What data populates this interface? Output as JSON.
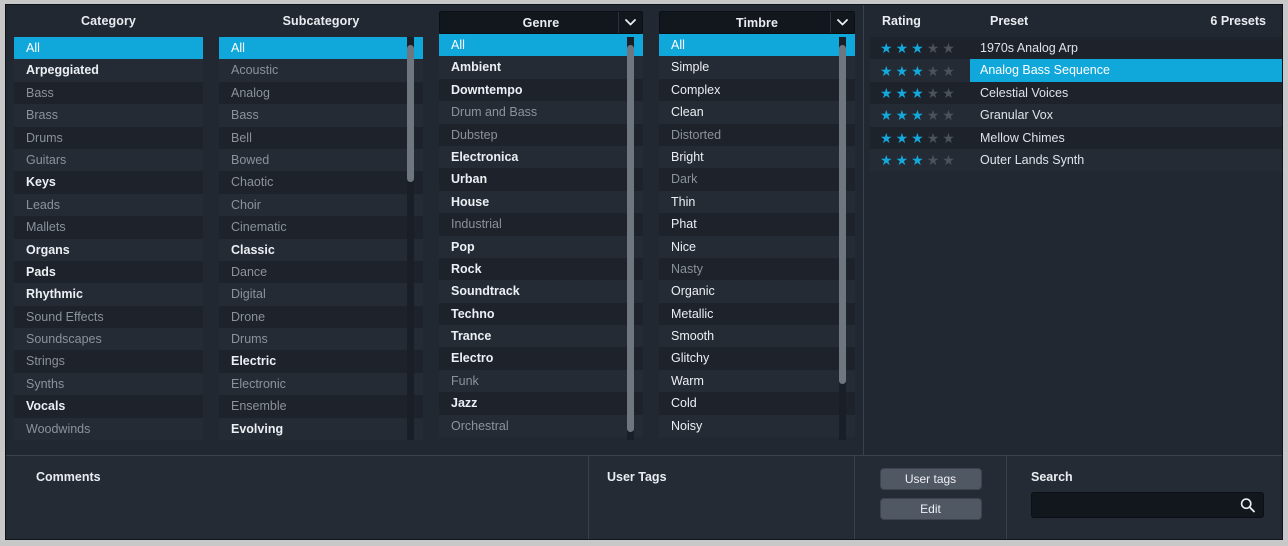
{
  "columns": {
    "category": {
      "title": "Category",
      "type": "static-header",
      "selected": "All",
      "items": [
        {
          "label": "All",
          "state": "selected"
        },
        {
          "label": "Arpeggiated",
          "state": "enabled"
        },
        {
          "label": "Bass",
          "state": "dimmed"
        },
        {
          "label": "Brass",
          "state": "dimmed"
        },
        {
          "label": "Drums",
          "state": "dimmed"
        },
        {
          "label": "Guitars",
          "state": "dimmed"
        },
        {
          "label": "Keys",
          "state": "enabled"
        },
        {
          "label": "Leads",
          "state": "dimmed"
        },
        {
          "label": "Mallets",
          "state": "dimmed"
        },
        {
          "label": "Organs",
          "state": "enabled"
        },
        {
          "label": "Pads",
          "state": "enabled"
        },
        {
          "label": "Rhythmic",
          "state": "enabled"
        },
        {
          "label": "Sound Effects",
          "state": "dimmed"
        },
        {
          "label": "Soundscapes",
          "state": "dimmed"
        },
        {
          "label": "Strings",
          "state": "dimmed"
        },
        {
          "label": "Synths",
          "state": "dimmed"
        },
        {
          "label": "Vocals",
          "state": "enabled"
        },
        {
          "label": "Woodwinds",
          "state": "dimmed"
        }
      ]
    },
    "subcategory": {
      "title": "Subcategory",
      "type": "static-header",
      "selected": "All",
      "scrollbar": {
        "visible": true,
        "thumb_top_pct": 2,
        "thumb_height_pct": 34
      },
      "items": [
        {
          "label": "All",
          "state": "selected"
        },
        {
          "label": "Acoustic",
          "state": "dimmed"
        },
        {
          "label": "Analog",
          "state": "dimmed"
        },
        {
          "label": "Bass",
          "state": "dimmed"
        },
        {
          "label": "Bell",
          "state": "dimmed"
        },
        {
          "label": "Bowed",
          "state": "dimmed"
        },
        {
          "label": "Chaotic",
          "state": "dimmed"
        },
        {
          "label": "Choir",
          "state": "dimmed"
        },
        {
          "label": "Cinematic",
          "state": "dimmed"
        },
        {
          "label": "Classic",
          "state": "enabled"
        },
        {
          "label": "Dance",
          "state": "dimmed"
        },
        {
          "label": "Digital",
          "state": "dimmed"
        },
        {
          "label": "Drone",
          "state": "dimmed"
        },
        {
          "label": "Drums",
          "state": "dimmed"
        },
        {
          "label": "Electric",
          "state": "enabled"
        },
        {
          "label": "Electronic",
          "state": "dimmed"
        },
        {
          "label": "Ensemble",
          "state": "dimmed"
        },
        {
          "label": "Evolving",
          "state": "enabled"
        }
      ]
    },
    "genre": {
      "title": "Genre",
      "type": "dropdown-header",
      "selected": "All",
      "scrollbar": {
        "visible": true,
        "thumb_top_pct": 2,
        "thumb_height_pct": 96
      },
      "items": [
        {
          "label": "All",
          "state": "selected"
        },
        {
          "label": "Ambient",
          "state": "enabled"
        },
        {
          "label": "Downtempo",
          "state": "enabled"
        },
        {
          "label": "Drum and Bass",
          "state": "dimmed"
        },
        {
          "label": "Dubstep",
          "state": "dimmed"
        },
        {
          "label": "Electronica",
          "state": "enabled"
        },
        {
          "label": "Urban",
          "state": "enabled"
        },
        {
          "label": "House",
          "state": "enabled"
        },
        {
          "label": "Industrial",
          "state": "dimmed"
        },
        {
          "label": "Pop",
          "state": "enabled"
        },
        {
          "label": "Rock",
          "state": "enabled"
        },
        {
          "label": "Soundtrack",
          "state": "enabled"
        },
        {
          "label": "Techno",
          "state": "enabled"
        },
        {
          "label": "Trance",
          "state": "enabled"
        },
        {
          "label": "Electro",
          "state": "enabled"
        },
        {
          "label": "Funk",
          "state": "dimmed"
        },
        {
          "label": "Jazz",
          "state": "enabled"
        },
        {
          "label": "Orchestral",
          "state": "dimmed"
        }
      ]
    },
    "timbre": {
      "title": "Timbre",
      "type": "dropdown-header",
      "selected": "All",
      "scrollbar": {
        "visible": true,
        "thumb_top_pct": 2,
        "thumb_height_pct": 84
      },
      "items": [
        {
          "label": "All",
          "state": "selected"
        },
        {
          "label": "Simple",
          "state": "plain"
        },
        {
          "label": "Complex",
          "state": "plain"
        },
        {
          "label": "Clean",
          "state": "plain"
        },
        {
          "label": "Distorted",
          "state": "dimmed"
        },
        {
          "label": "Bright",
          "state": "plain"
        },
        {
          "label": "Dark",
          "state": "dimmed"
        },
        {
          "label": "Thin",
          "state": "plain"
        },
        {
          "label": "Phat",
          "state": "plain"
        },
        {
          "label": "Nice",
          "state": "plain"
        },
        {
          "label": "Nasty",
          "state": "dimmed"
        },
        {
          "label": "Organic",
          "state": "plain"
        },
        {
          "label": "Metallic",
          "state": "plain"
        },
        {
          "label": "Smooth",
          "state": "plain"
        },
        {
          "label": "Glitchy",
          "state": "plain"
        },
        {
          "label": "Warm",
          "state": "plain"
        },
        {
          "label": "Cold",
          "state": "plain"
        },
        {
          "label": "Noisy",
          "state": "plain"
        }
      ]
    }
  },
  "presets": {
    "header": {
      "rating": "Rating",
      "preset": "Preset",
      "count": "6 Presets"
    },
    "max_rating": 5,
    "selected": "Analog Bass Sequence",
    "rows": [
      {
        "name": "1970s Analog Arp",
        "rating": 3,
        "selected": false
      },
      {
        "name": "Analog Bass Sequence",
        "rating": 3,
        "selected": true
      },
      {
        "name": "Celestial Voices",
        "rating": 3,
        "selected": false
      },
      {
        "name": "Granular Vox",
        "rating": 3,
        "selected": false
      },
      {
        "name": "Mellow Chimes",
        "rating": 3,
        "selected": false
      },
      {
        "name": "Outer Lands Synth",
        "rating": 3,
        "selected": false
      }
    ]
  },
  "bottom": {
    "comments_label": "Comments",
    "comments_value": "",
    "usertags_label": "User Tags",
    "usertags_value": "",
    "user_tags_button": "User tags",
    "edit_button": "Edit",
    "search_label": "Search",
    "search_value": "",
    "search_placeholder": ""
  },
  "colors": {
    "accent": "#10a7da",
    "star_on": "#14a9dc",
    "star_off": "#4a525c",
    "panel": "#222831",
    "row_odd": "#1d222b",
    "row_even": "#252b35",
    "text": "#ecf0f4",
    "text_dim": "#8b929c",
    "button": "#505864"
  }
}
